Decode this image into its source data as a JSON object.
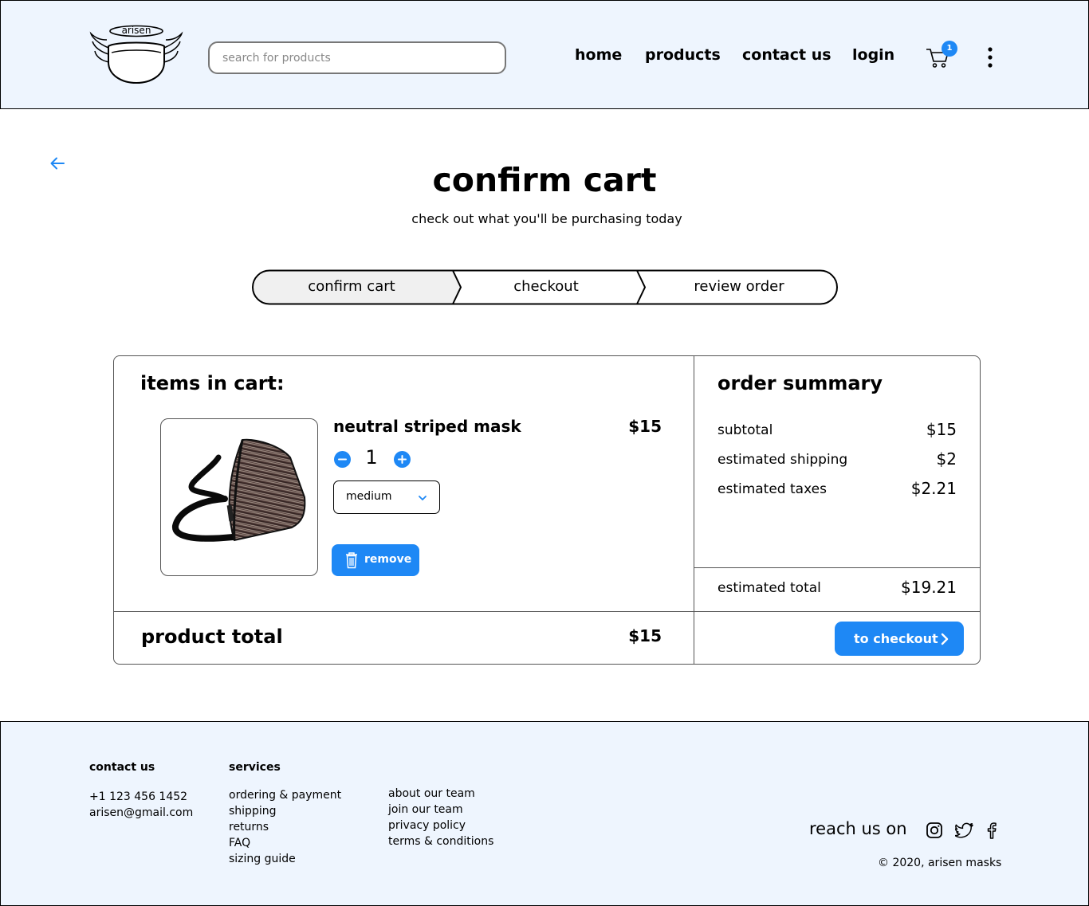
{
  "header": {
    "logo_text": "arisen",
    "search_placeholder": "search for products",
    "nav": [
      "home",
      "products",
      "contact us",
      "login"
    ],
    "cart_count": "1"
  },
  "main": {
    "title": "confirm cart",
    "subtitle": "check out what you'll be purchasing today",
    "steps": [
      "confirm cart",
      "checkout",
      "review order"
    ],
    "active_step": 0
  },
  "cart": {
    "heading": "items in cart:",
    "item": {
      "name": "neutral striped mask",
      "price": "$15",
      "quantity": "1",
      "size": "medium",
      "remove_label": "remove"
    },
    "product_total_label": "product total",
    "product_total": "$15"
  },
  "summary": {
    "heading": "order summary",
    "rows": [
      {
        "label": "subtotal",
        "value": "$15"
      },
      {
        "label": "estimated shipping",
        "value": "$2"
      },
      {
        "label": "estimated taxes",
        "value": "$2.21"
      }
    ],
    "total_label": "estimated total",
    "total_value": "$19.21",
    "checkout_label": "to checkout"
  },
  "footer": {
    "contact_heading": "contact us",
    "phone": "+1 123 456 1452",
    "email": "arisen@gmail.com",
    "services_heading": "services",
    "services": [
      "ordering & payment",
      "shipping",
      "returns",
      "FAQ",
      "sizing guide"
    ],
    "company": [
      "about our team",
      "join our team",
      "privacy policy",
      "terms & conditions"
    ],
    "reach_label": "reach us on",
    "social_icons": [
      "instagram-icon",
      "twitter-icon",
      "facebook-icon"
    ],
    "copyright": "© 2020, arisen masks"
  },
  "colors": {
    "accent": "#1e88f5",
    "header_bg": "#eef5fe",
    "active_step_bg": "#f0f0f0"
  }
}
